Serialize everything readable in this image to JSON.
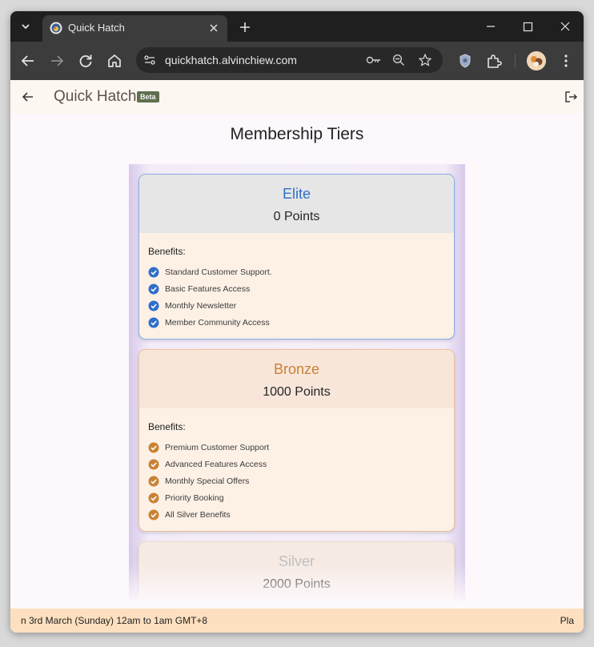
{
  "browser": {
    "tab": {
      "title": "Quick Hatch"
    },
    "omnibox": {
      "url": "quickhatch.alvinchiew.com"
    }
  },
  "app": {
    "title": "Quick Hatch",
    "badge": "Beta",
    "page_title": "Membership Tiers"
  },
  "tiers": [
    {
      "name": "Elite",
      "points": "0 Points",
      "color": "#2f6fc9",
      "benefits_label": "Benefits:",
      "benefits": [
        "Standard Customer Support.",
        "Basic Features Access",
        "Monthly Newsletter",
        "Member Community Access"
      ]
    },
    {
      "name": "Bronze",
      "points": "1000 Points",
      "color": "#c98235",
      "benefits_label": "Benefits:",
      "benefits": [
        "Premium Customer Support",
        "Advanced Features Access",
        "Monthly Special Offers",
        "Priority Booking",
        "All Silver Benefits"
      ]
    },
    {
      "name": "Silver",
      "points": "2000 Points",
      "color": "#bfbfbf"
    }
  ],
  "banner": {
    "text": "n 3rd March (Sunday) 12am to 1am GMT+8",
    "right_text": "Pla"
  }
}
